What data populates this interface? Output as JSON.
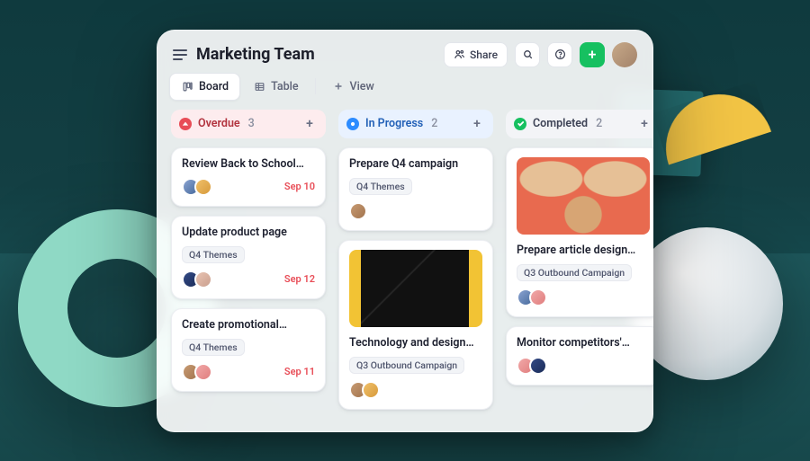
{
  "header": {
    "title": "Marketing Team",
    "share_label": "Share"
  },
  "tabs": {
    "board": "Board",
    "table": "Table",
    "add_view": "View"
  },
  "columns": [
    {
      "id": "overdue",
      "label": "Overdue",
      "count": "3",
      "cards": [
        {
          "title": "Review Back to School…",
          "tag": null,
          "due": "Sep 10",
          "assignees": [
            "#8aa3d1,#476a9c",
            "#f0c06a,#d79a3b"
          ],
          "image": null
        },
        {
          "title": "Update product page",
          "tag": "Q4 Themes",
          "due": "Sep 12",
          "assignees": [
            "#334a86,#1b2c58",
            "#e9c3b2,#caa08f"
          ],
          "image": null
        },
        {
          "title": "Create promotional…",
          "tag": "Q4 Themes",
          "due": "Sep 11",
          "assignees": [
            "#c79a72,#a2744e",
            "#f1a8a8,#e07e7e"
          ],
          "image": null
        }
      ]
    },
    {
      "id": "progress",
      "label": "In Progress",
      "count": "2",
      "cards": [
        {
          "title": "Prepare Q4 campaign",
          "tag": "Q4 Themes",
          "due": null,
          "assignees": [
            "#c79a72,#a2744e"
          ],
          "image": null
        },
        {
          "title": "Technology and design…",
          "tag": "Q3 Outbound Campaign",
          "due": null,
          "assignees": [
            "#c79a72,#a2744e",
            "#f0c06a,#d79a3b"
          ],
          "image": "tablet"
        }
      ]
    },
    {
      "id": "completed",
      "label": "Completed",
      "count": "2",
      "cards": [
        {
          "title": "Prepare article design…",
          "tag": "Q3 Outbound Campaign",
          "due": null,
          "assignees": [
            "#8aa3d1,#476a9c",
            "#f1a8a8,#e07e7e"
          ],
          "image": "dog"
        },
        {
          "title": "Monitor competitors'…",
          "tag": null,
          "due": null,
          "assignees": [
            "#f1a8a8,#e07e7e",
            "#334a86,#1b2c58"
          ],
          "image": null
        }
      ]
    }
  ]
}
